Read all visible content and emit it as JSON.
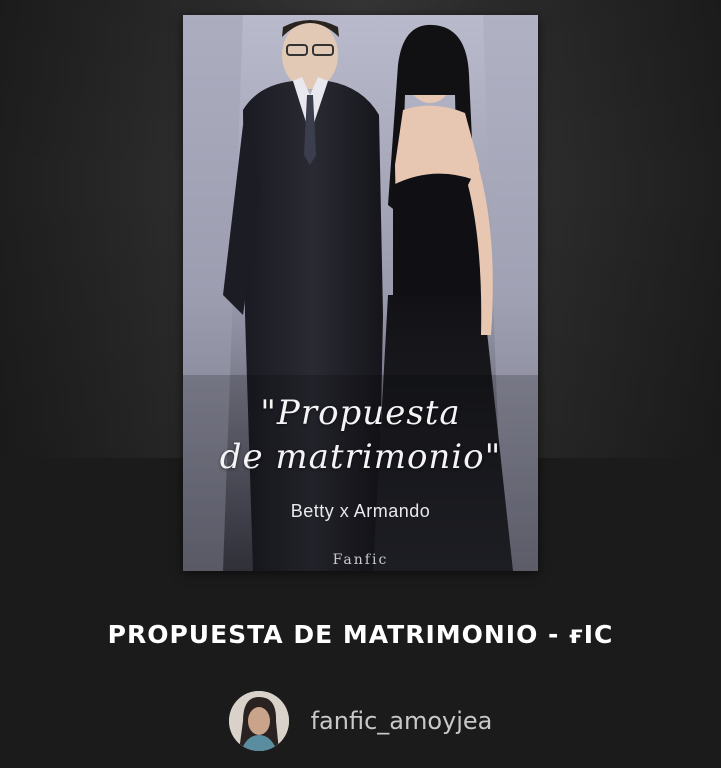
{
  "cover": {
    "title_line1": "\"Propuesta",
    "title_line2": "de matrimonio\"",
    "couple": "Betty x Armando",
    "tag": "Fanfic"
  },
  "story": {
    "title": "PROPUESTA DE MATRIMONIO - ғIC"
  },
  "author": {
    "username": "fanfic_amoyjea"
  },
  "colors": {
    "background": "#1b1b1b",
    "title_text": "#ffffff",
    "author_text": "#c9c9c9"
  }
}
